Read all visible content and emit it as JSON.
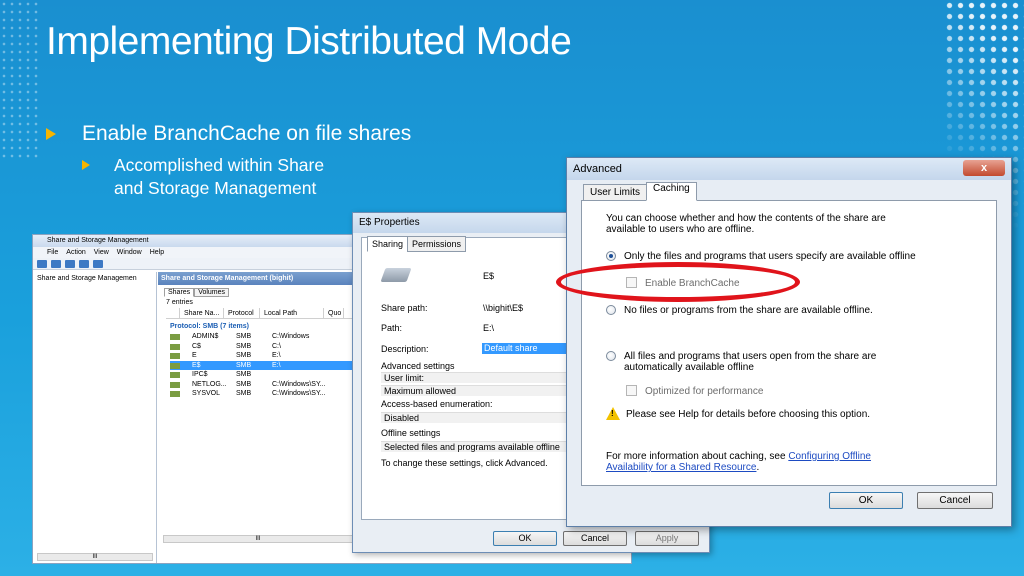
{
  "slide": {
    "title": "Implementing Distributed Mode",
    "bullet1": "Enable BranchCache on file shares",
    "bullet2_line1": "Accomplished within Share",
    "bullet2_line2": "and Storage Management",
    "colors": {
      "background": "#1a9ad6",
      "bullet": "#f7b500",
      "highlight_ring": "#e0141b"
    }
  },
  "ssm": {
    "title": "Share and Storage Management",
    "menu": [
      "File",
      "Action",
      "View",
      "Window",
      "Help"
    ],
    "tree_item": "Share and Storage Managemen",
    "pane_header": "Share and Storage Management (bighit)",
    "tabs": [
      "Shares",
      "Volumes"
    ],
    "entries": "7 entries",
    "columns": [
      "Share Na...",
      "Protocol",
      "Local Path",
      "Quo"
    ],
    "group": "Protocol: SMB (7 items)",
    "rows": [
      {
        "name": "ADMIN$",
        "protocol": "SMB",
        "path": "C:\\Windows"
      },
      {
        "name": "C$",
        "protocol": "SMB",
        "path": "C:\\"
      },
      {
        "name": "E",
        "protocol": "SMB",
        "path": "E:\\"
      },
      {
        "name": "E$",
        "protocol": "SMB",
        "path": "E:\\"
      },
      {
        "name": "IPC$",
        "protocol": "SMB",
        "path": ""
      },
      {
        "name": "NETLOG...",
        "protocol": "SMB",
        "path": "C:\\Windows\\SY..."
      },
      {
        "name": "SYSVOL",
        "protocol": "SMB",
        "path": "C:\\Windows\\SY..."
      }
    ],
    "scroll_mark": "III"
  },
  "props": {
    "title": "E$ Properties",
    "tabs": [
      "Sharing",
      "Permissions"
    ],
    "share_name": "E$",
    "share_path_label": "Share path:",
    "share_path": "\\\\bighit\\E$",
    "path_label": "Path:",
    "path": "E:\\",
    "description_label": "Description:",
    "description": "Default share",
    "advanced_settings": "Advanced settings",
    "user_limit_label": "User limit:",
    "user_limit": "Maximum allowed",
    "abe_label": "Access-based enumeration:",
    "abe": "Disabled",
    "offline_label": "Offline settings",
    "offline": "Selected files and programs available offline",
    "change_note": "To change these settings, click Advanced.",
    "ok": "OK",
    "cancel": "Cancel",
    "apply": "Apply"
  },
  "advanced": {
    "title": "Advanced",
    "close": "x",
    "tabs": [
      "User Limits",
      "Caching"
    ],
    "intro_line1": "You can choose whether and how the contents of the share are",
    "intro_line2": "available to users who are offline.",
    "option1": "Only the files and programs that users specify are available offline",
    "enable_branchcache": "Enable BranchCache",
    "option2": "No files or programs from the share are available offline.",
    "option3_line1": "All files and programs that users open from the share are",
    "option3_line2": "automatically available offline",
    "optimized": "Optimized for performance",
    "warning": "Please see Help for details before choosing this option.",
    "more_info": "For more information about caching, see",
    "link_line1": "Configuring Offline",
    "link_line2": "Availability for a Shared Resource",
    "link_end": ".",
    "ok": "OK",
    "cancel": "Cancel"
  }
}
